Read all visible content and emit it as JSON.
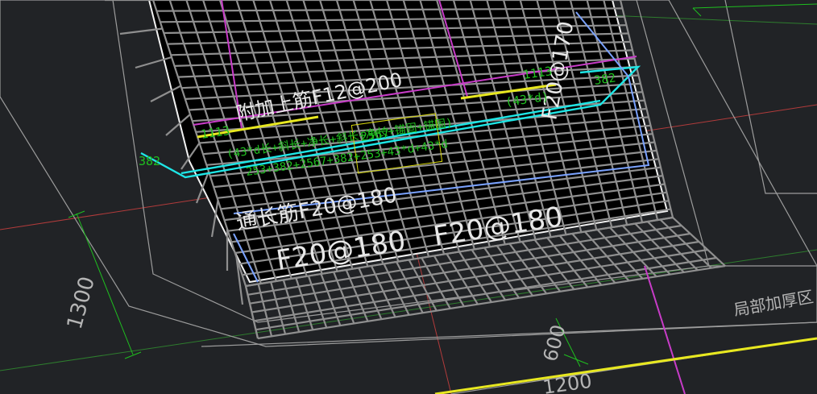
{
  "labels": {
    "rebar_tag_main": "F20@180",
    "rebar_tag_2": "F20@180",
    "rebar_tag_left": "通长筋F20@180",
    "rebar_tag_top": "附加上筋F12@200",
    "rebar_tag_right": "F20@170",
    "seg_left": "1113",
    "seg_center": "2567",
    "seg_right": "1113",
    "seg_right_offset": "(43*d)",
    "edge_left": "382",
    "edge_right": "382",
    "formula_1": "(43*d长+斜长+净长+斜长+净长+锚固+锚固)",
    "formula_2": "253+382+2567+382+253+43*d+43*d",
    "dim_left": "1300",
    "dim_bottom": "600",
    "dim_bottom_right": "1200",
    "zone_label": "局部加厚区"
  },
  "colors": {
    "background": "#212326",
    "mesh": "#8f8f8f",
    "dim_green": "#1fbf1f",
    "cyan": "#1ee6e6",
    "yellow": "#e8e820",
    "magenta": "#c83cc8",
    "red_axis": "#b23b3b",
    "blue_bar": "#7aa2ff"
  }
}
